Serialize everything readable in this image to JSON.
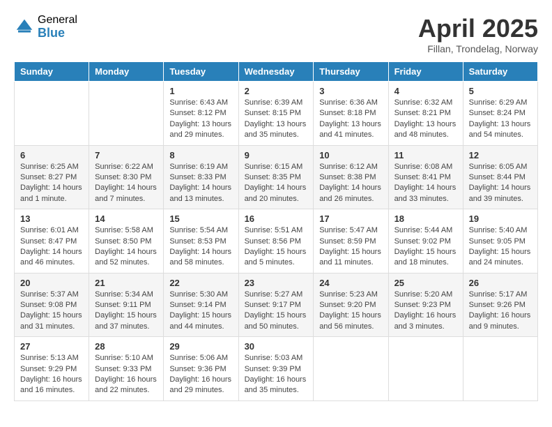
{
  "logo": {
    "general": "General",
    "blue": "Blue"
  },
  "header": {
    "month": "April 2025",
    "location": "Fillan, Trondelag, Norway"
  },
  "days_of_week": [
    "Sunday",
    "Monday",
    "Tuesday",
    "Wednesday",
    "Thursday",
    "Friday",
    "Saturday"
  ],
  "weeks": [
    [
      {
        "day": "",
        "info": ""
      },
      {
        "day": "",
        "info": ""
      },
      {
        "day": "1",
        "info": "Sunrise: 6:43 AM\nSunset: 8:12 PM\nDaylight: 13 hours and 29 minutes."
      },
      {
        "day": "2",
        "info": "Sunrise: 6:39 AM\nSunset: 8:15 PM\nDaylight: 13 hours and 35 minutes."
      },
      {
        "day": "3",
        "info": "Sunrise: 6:36 AM\nSunset: 8:18 PM\nDaylight: 13 hours and 41 minutes."
      },
      {
        "day": "4",
        "info": "Sunrise: 6:32 AM\nSunset: 8:21 PM\nDaylight: 13 hours and 48 minutes."
      },
      {
        "day": "5",
        "info": "Sunrise: 6:29 AM\nSunset: 8:24 PM\nDaylight: 13 hours and 54 minutes."
      }
    ],
    [
      {
        "day": "6",
        "info": "Sunrise: 6:25 AM\nSunset: 8:27 PM\nDaylight: 14 hours and 1 minute."
      },
      {
        "day": "7",
        "info": "Sunrise: 6:22 AM\nSunset: 8:30 PM\nDaylight: 14 hours and 7 minutes."
      },
      {
        "day": "8",
        "info": "Sunrise: 6:19 AM\nSunset: 8:33 PM\nDaylight: 14 hours and 13 minutes."
      },
      {
        "day": "9",
        "info": "Sunrise: 6:15 AM\nSunset: 8:35 PM\nDaylight: 14 hours and 20 minutes."
      },
      {
        "day": "10",
        "info": "Sunrise: 6:12 AM\nSunset: 8:38 PM\nDaylight: 14 hours and 26 minutes."
      },
      {
        "day": "11",
        "info": "Sunrise: 6:08 AM\nSunset: 8:41 PM\nDaylight: 14 hours and 33 minutes."
      },
      {
        "day": "12",
        "info": "Sunrise: 6:05 AM\nSunset: 8:44 PM\nDaylight: 14 hours and 39 minutes."
      }
    ],
    [
      {
        "day": "13",
        "info": "Sunrise: 6:01 AM\nSunset: 8:47 PM\nDaylight: 14 hours and 46 minutes."
      },
      {
        "day": "14",
        "info": "Sunrise: 5:58 AM\nSunset: 8:50 PM\nDaylight: 14 hours and 52 minutes."
      },
      {
        "day": "15",
        "info": "Sunrise: 5:54 AM\nSunset: 8:53 PM\nDaylight: 14 hours and 58 minutes."
      },
      {
        "day": "16",
        "info": "Sunrise: 5:51 AM\nSunset: 8:56 PM\nDaylight: 15 hours and 5 minutes."
      },
      {
        "day": "17",
        "info": "Sunrise: 5:47 AM\nSunset: 8:59 PM\nDaylight: 15 hours and 11 minutes."
      },
      {
        "day": "18",
        "info": "Sunrise: 5:44 AM\nSunset: 9:02 PM\nDaylight: 15 hours and 18 minutes."
      },
      {
        "day": "19",
        "info": "Sunrise: 5:40 AM\nSunset: 9:05 PM\nDaylight: 15 hours and 24 minutes."
      }
    ],
    [
      {
        "day": "20",
        "info": "Sunrise: 5:37 AM\nSunset: 9:08 PM\nDaylight: 15 hours and 31 minutes."
      },
      {
        "day": "21",
        "info": "Sunrise: 5:34 AM\nSunset: 9:11 PM\nDaylight: 15 hours and 37 minutes."
      },
      {
        "day": "22",
        "info": "Sunrise: 5:30 AM\nSunset: 9:14 PM\nDaylight: 15 hours and 44 minutes."
      },
      {
        "day": "23",
        "info": "Sunrise: 5:27 AM\nSunset: 9:17 PM\nDaylight: 15 hours and 50 minutes."
      },
      {
        "day": "24",
        "info": "Sunrise: 5:23 AM\nSunset: 9:20 PM\nDaylight: 15 hours and 56 minutes."
      },
      {
        "day": "25",
        "info": "Sunrise: 5:20 AM\nSunset: 9:23 PM\nDaylight: 16 hours and 3 minutes."
      },
      {
        "day": "26",
        "info": "Sunrise: 5:17 AM\nSunset: 9:26 PM\nDaylight: 16 hours and 9 minutes."
      }
    ],
    [
      {
        "day": "27",
        "info": "Sunrise: 5:13 AM\nSunset: 9:29 PM\nDaylight: 16 hours and 16 minutes."
      },
      {
        "day": "28",
        "info": "Sunrise: 5:10 AM\nSunset: 9:33 PM\nDaylight: 16 hours and 22 minutes."
      },
      {
        "day": "29",
        "info": "Sunrise: 5:06 AM\nSunset: 9:36 PM\nDaylight: 16 hours and 29 minutes."
      },
      {
        "day": "30",
        "info": "Sunrise: 5:03 AM\nSunset: 9:39 PM\nDaylight: 16 hours and 35 minutes."
      },
      {
        "day": "",
        "info": ""
      },
      {
        "day": "",
        "info": ""
      },
      {
        "day": "",
        "info": ""
      }
    ]
  ]
}
